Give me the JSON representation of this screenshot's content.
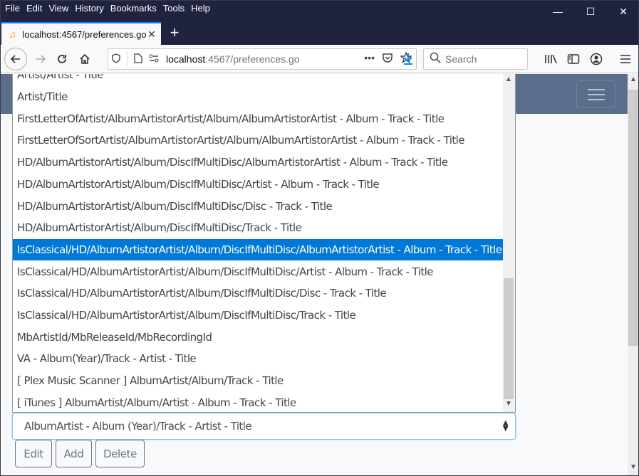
{
  "browser": {
    "menu": [
      "File",
      "Edit",
      "View",
      "History",
      "Bookmarks",
      "Tools",
      "Help"
    ],
    "menu_access_keys": [
      "F",
      "E",
      "V",
      "s",
      "B",
      "T",
      "H"
    ],
    "tab": {
      "title": "localhost:4567/preferences.go",
      "icon": "music-note-icon"
    },
    "url": {
      "host": "localhost",
      "rest": ":4567/preferences.go"
    },
    "search_placeholder": "Search",
    "window_controls": {
      "minimize": "—",
      "maximize": "☐",
      "close": "✕"
    }
  },
  "list": {
    "options": [
      "Artist/Artist - Title",
      "Artist/Title",
      "FirstLetterOfArtist/AlbumArtistorArtist/Album/AlbumArtistorArtist - Album - Track - Title",
      "FirstLetterOfSortArtist/AlbumArtistorArtist/Album/AlbumArtistorArtist - Album - Track - Title",
      "HD/AlbumArtistorArtist/Album/DiscIfMultiDisc/AlbumArtistorArtist - Album - Track - Title",
      "HD/AlbumArtistorArtist/Album/DiscIfMultiDisc/Artist - Album - Track - Title",
      "HD/AlbumArtistorArtist/Album/DiscIfMultiDisc/Disc - Track - Title",
      "HD/AlbumArtistorArtist/Album/DiscIfMultiDisc/Track - Title",
      "IsClassical/HD/AlbumArtistorArtist/Album/DiscIfMultiDisc/AlbumArtistorArtist - Album - Track - Title",
      "IsClassical/HD/AlbumArtistorArtist/Album/DiscIfMultiDisc/Artist - Album - Track - Title",
      "IsClassical/HD/AlbumArtistorArtist/Album/DiscIfMultiDisc/Disc - Track - Title",
      "IsClassical/HD/AlbumArtistorArtist/Album/DiscIfMultiDisc/Track - Title",
      "MbArtistId/MbReleaseId/MbRecordingId",
      "VA - Album(Year)/Track - Artist - Title",
      "[ Plex Music Scanner ] AlbumArtist/Album/Track - Title",
      "[ iTunes ] AlbumArtist/Album/Artist - Album - Track - Title"
    ],
    "highlighted_index": 8
  },
  "select": {
    "value": "AlbumArtist - Album (Year)/Track - Artist - Title"
  },
  "buttons": {
    "edit": "Edit",
    "add": "Add",
    "delete": "Delete"
  },
  "colors": {
    "highlight": "#0078d7",
    "header": "#5a6e8c",
    "titlebar": "#1f2340"
  }
}
